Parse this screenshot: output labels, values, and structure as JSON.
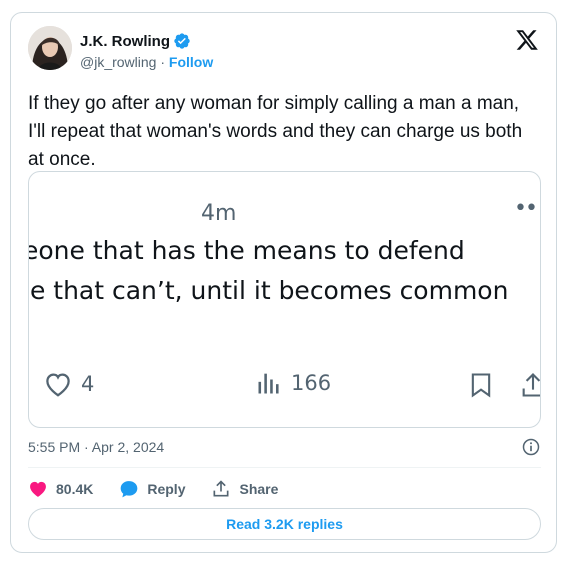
{
  "author": {
    "display_name": "J.K. Rowling",
    "handle": "@jk_rowling",
    "separator": "·",
    "follow_label": "Follow",
    "verified": true
  },
  "brand_icon": "x-logo-icon",
  "tweet": {
    "text": "If they go after any woman for simply calling a man a man, I'll repeat that woman's words and they can charge us both at once.",
    "timestamp": "5:55 PM · Apr 2, 2024"
  },
  "media": {
    "time": "4m",
    "dots": "••",
    "line1": "eone that has the means to defend",
    "line2": "le that can’t, until it becomes common",
    "likes": "4",
    "views": "166"
  },
  "actions": {
    "likes": "80.4K",
    "reply_label": "Reply",
    "share_label": "Share"
  },
  "read_replies_label": "Read 3.2K replies",
  "colors": {
    "accent": "#1d9bf0",
    "like": "#f91880",
    "text": "#0f1419",
    "muted": "#536471",
    "border": "#cfd9de"
  }
}
